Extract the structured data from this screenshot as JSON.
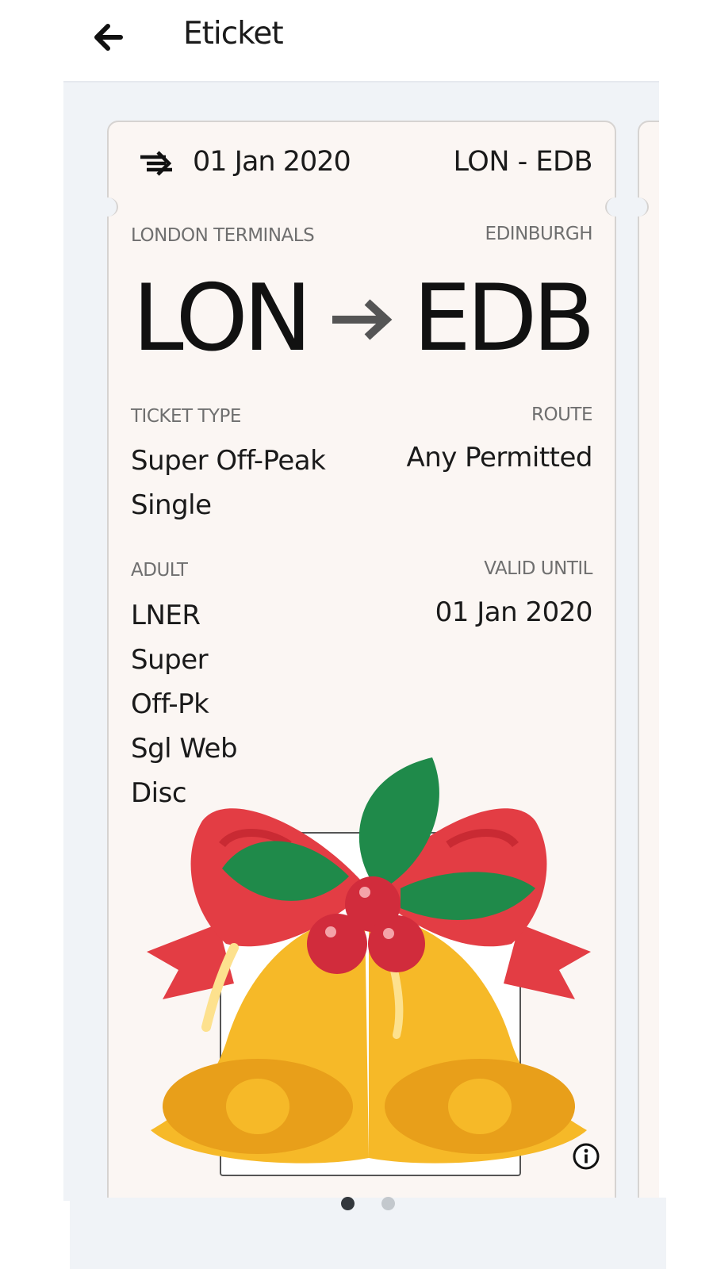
{
  "header": {
    "back_icon": "arrow-left-icon",
    "title": "Eticket"
  },
  "ticket": {
    "rail_icon": "national-rail-icon",
    "travel_date": "01 Jan 2020",
    "route_code": "LON - EDB",
    "origin_name": "LONDON TERMINALS",
    "destination_name": "EDINBURGH",
    "origin_code": "LON",
    "destination_code": "EDB",
    "ticket_type_label": "TICKET TYPE",
    "ticket_type_lines": [
      "Super Off-Peak",
      "Single"
    ],
    "route_label": "ROUTE",
    "route_value": "Any Permitted",
    "passenger_label": "ADULT",
    "fare_lines": [
      "LNER",
      "Super",
      "Off-Pk",
      "Sgl Web",
      "Disc"
    ],
    "valid_until_label": "VALID UNTIL",
    "valid_until_value": "01 Jan 2020",
    "info_icon": "info-icon",
    "sticker": "christmas-bells-sticker"
  },
  "pagination": {
    "count": 2,
    "active": 1
  },
  "colors": {
    "background": "#f0f3f7",
    "ticket": "#fbf6f3",
    "bell_gold": "#f6b928",
    "bow_red": "#e33d44",
    "holly_green": "#1f8a4a"
  }
}
